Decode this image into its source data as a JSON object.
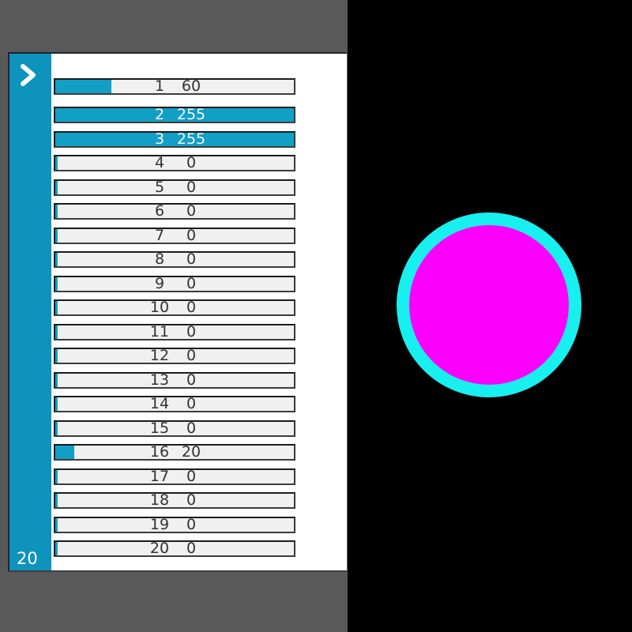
{
  "left_panel": {
    "background": "#595959",
    "panel_background": "#ffffff",
    "sidebar": {
      "color": "#0d93bc",
      "expand_icon": "chevron-right",
      "page_label": "20"
    },
    "sliders": {
      "min": 0,
      "max": 255,
      "fill_color": "#129fc6",
      "track_color": "#f0f0f0",
      "rows": [
        {
          "index": 1,
          "value": 60
        },
        {
          "index": 2,
          "value": 255
        },
        {
          "index": 3,
          "value": 255
        },
        {
          "index": 4,
          "value": 0
        },
        {
          "index": 5,
          "value": 0
        },
        {
          "index": 6,
          "value": 0
        },
        {
          "index": 7,
          "value": 0
        },
        {
          "index": 8,
          "value": 0
        },
        {
          "index": 9,
          "value": 0
        },
        {
          "index": 10,
          "value": 0
        },
        {
          "index": 11,
          "value": 0
        },
        {
          "index": 12,
          "value": 0
        },
        {
          "index": 13,
          "value": 0
        },
        {
          "index": 14,
          "value": 0
        },
        {
          "index": 15,
          "value": 0
        },
        {
          "index": 16,
          "value": 20
        },
        {
          "index": 17,
          "value": 0
        },
        {
          "index": 18,
          "value": 0
        },
        {
          "index": 19,
          "value": 0
        },
        {
          "index": 20,
          "value": 0
        }
      ]
    }
  },
  "right_panel": {
    "background": "#000000",
    "circle": {
      "fill_color": "#fb00fb",
      "ring_color": "#18efef"
    }
  }
}
